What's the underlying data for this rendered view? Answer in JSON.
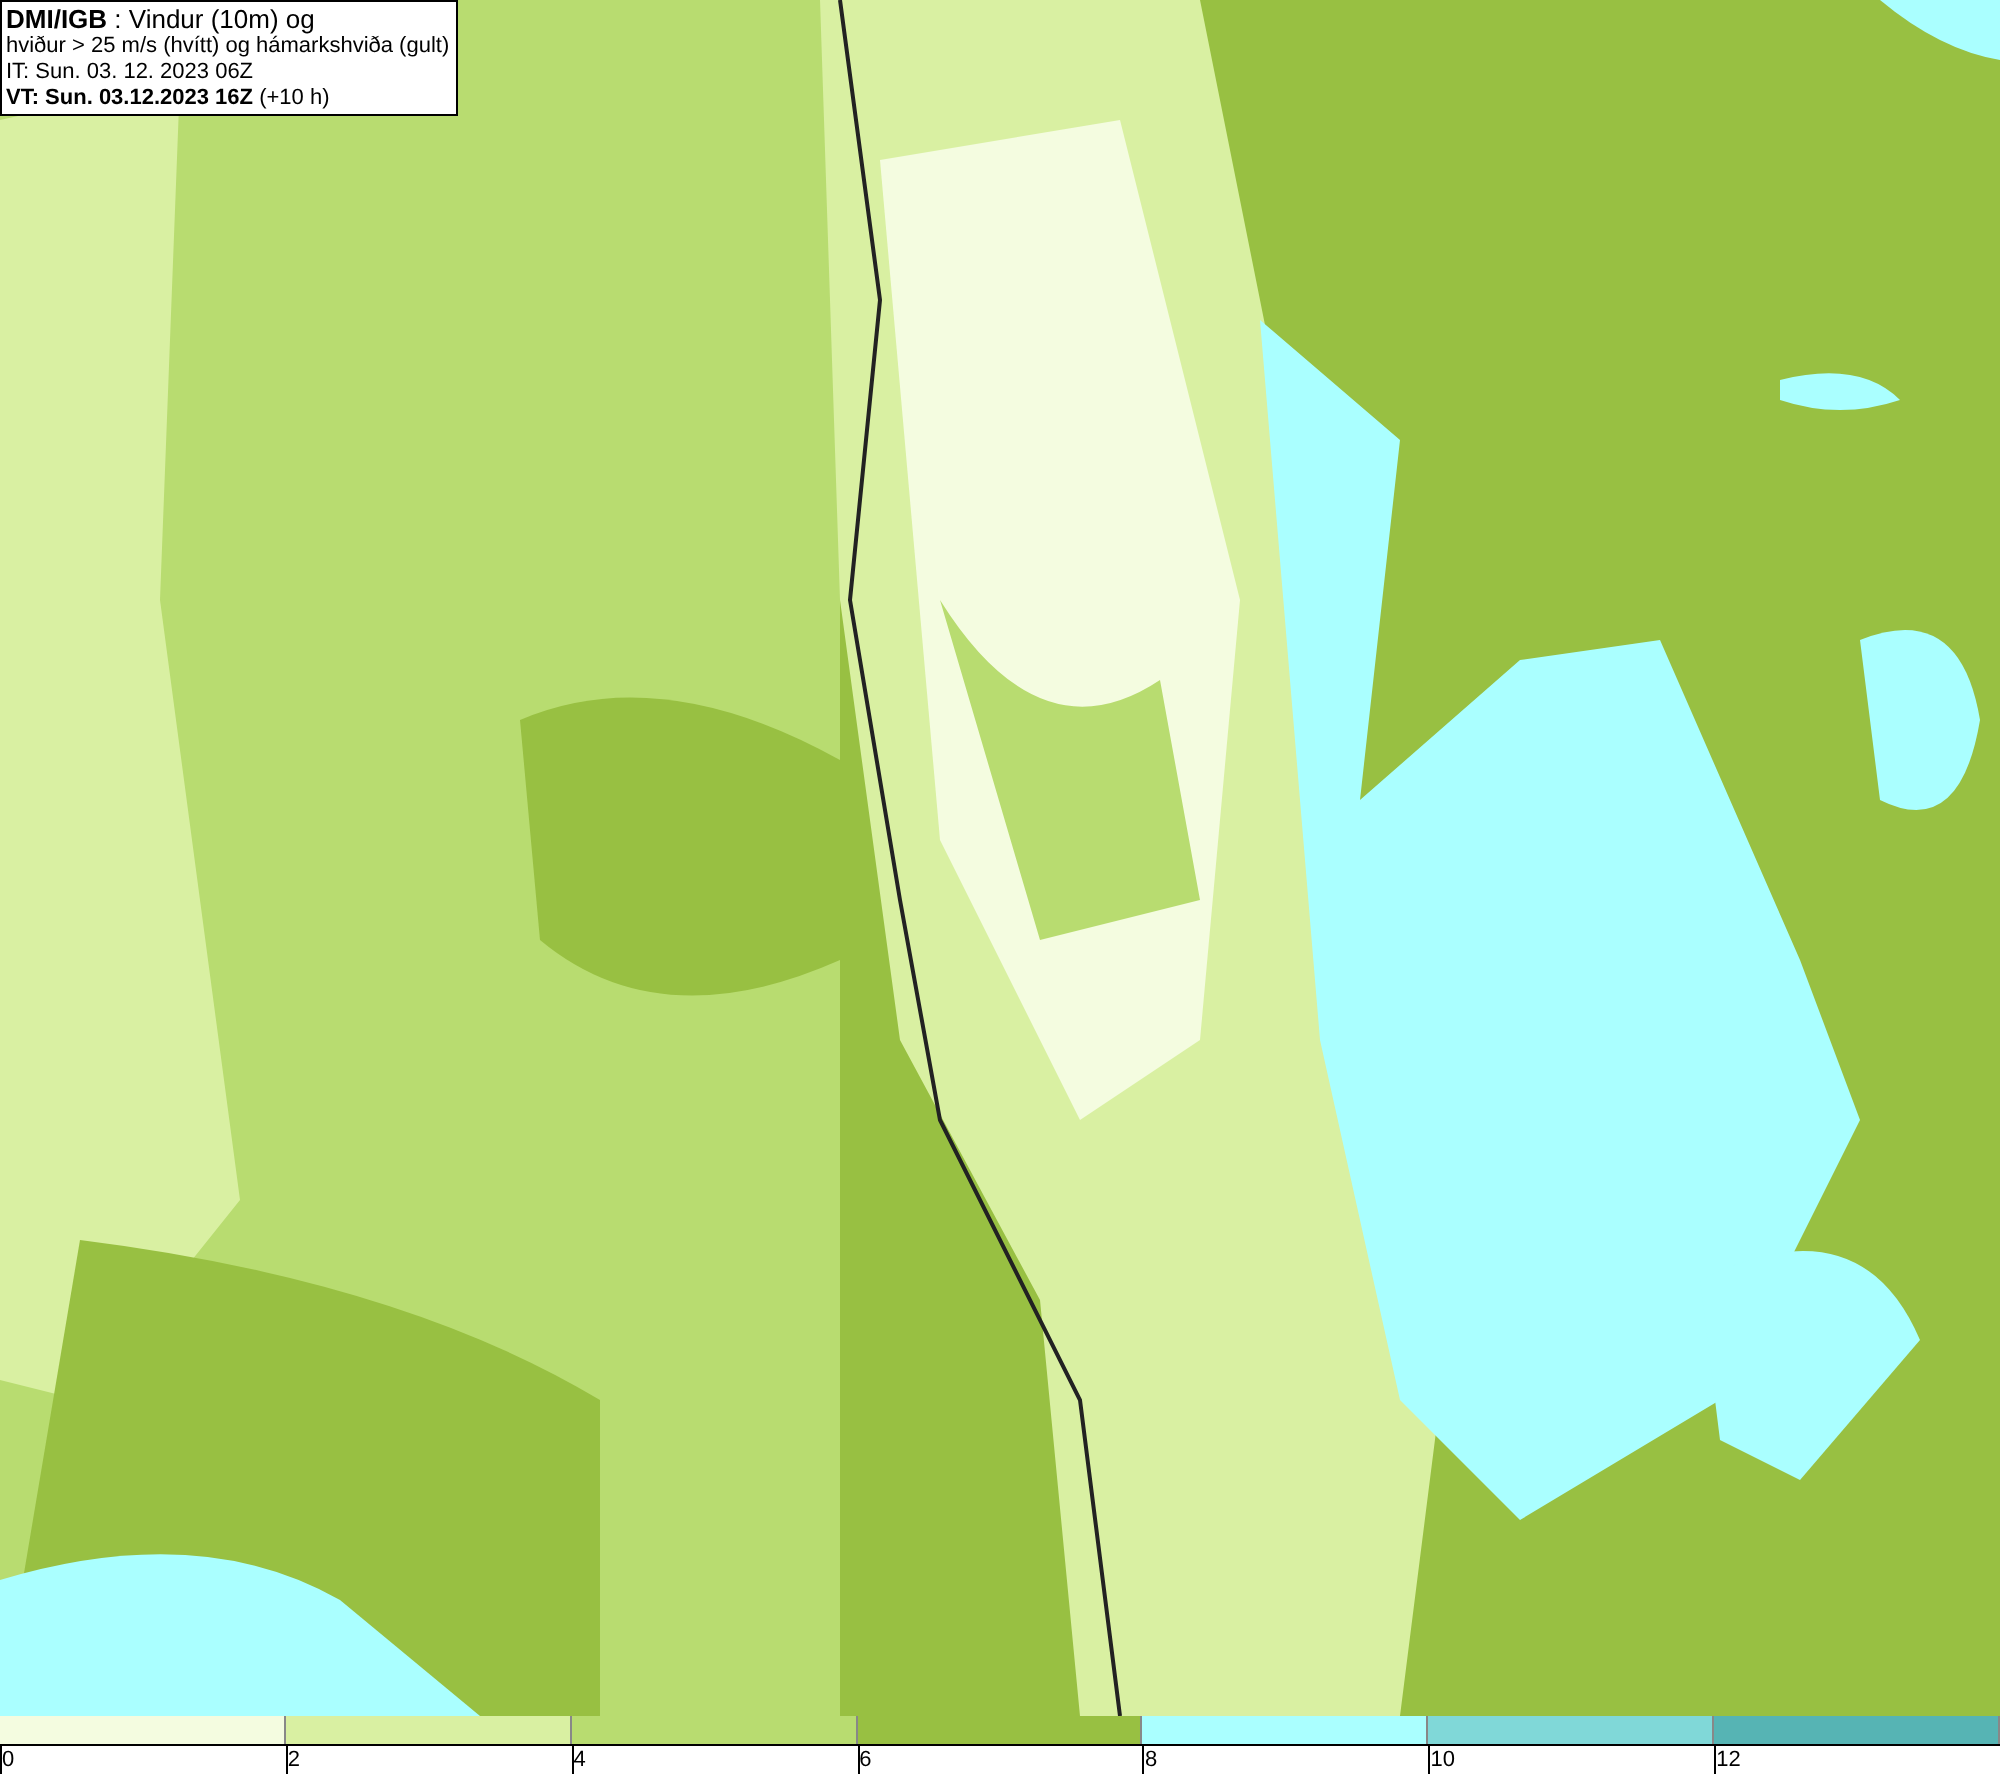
{
  "header": {
    "lines": [
      "**DMI/IGB** : Vindur (10m) og",
      "hviður > 25 m/s (hvítt) og hámarkshviða (gult)",
      "IT: Sun. 03. 12. 2023 06Z",
      "**VT: Sun. 03.12.2023 16Z** (+10 h)"
    ]
  },
  "legend": {
    "bins": [
      {
        "label": "0",
        "color": "#f4fce0"
      },
      {
        "label": "2",
        "color": "#d9f0a2"
      },
      {
        "label": "4",
        "color": "#b8dc70"
      },
      {
        "label": "6",
        "color": "#98c042"
      },
      {
        "label": "8",
        "color": "#aaffff"
      },
      {
        "label": "10",
        "color": "#80d8d8"
      },
      {
        "label": "12",
        "color": "#56b4b4"
      }
    ]
  }
}
